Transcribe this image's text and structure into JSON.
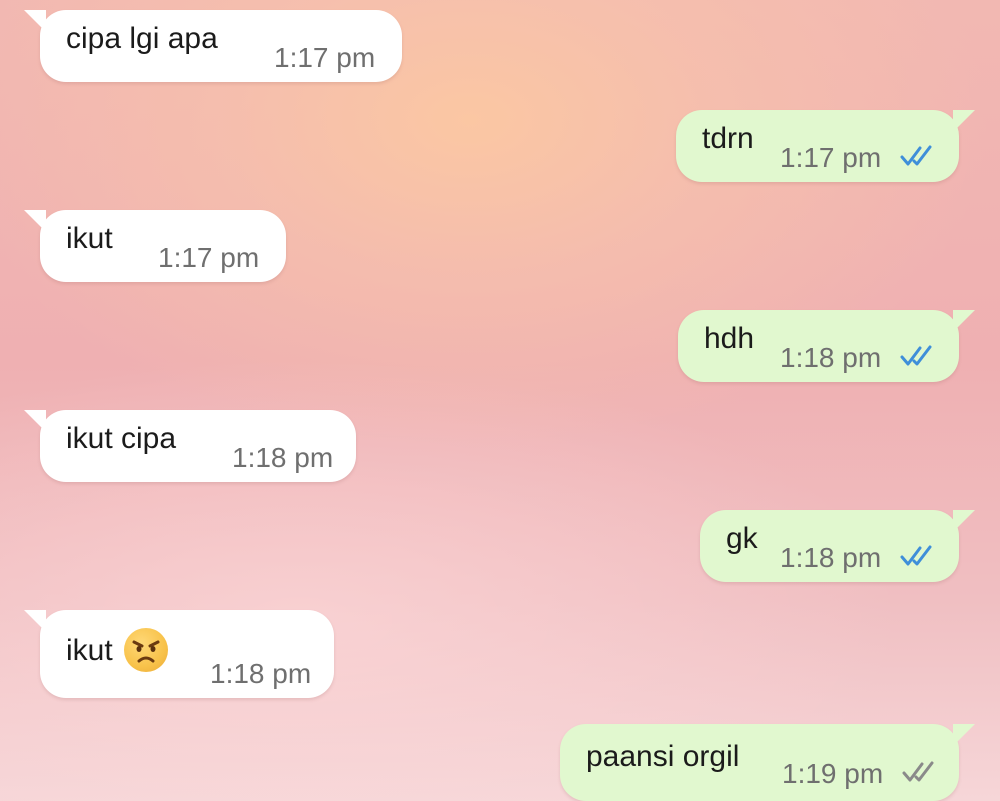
{
  "messages": [
    {
      "direction": "incoming",
      "text": "cipa lgi apa",
      "time": "1:17 pm"
    },
    {
      "direction": "outgoing",
      "text": "tdrn",
      "time": "1:17 pm",
      "status": "read",
      "status_icon": "double-check-icon",
      "status_color": "#3f8fd9"
    },
    {
      "direction": "incoming",
      "text": "ikut",
      "time": "1:17 pm"
    },
    {
      "direction": "outgoing",
      "text": "hdh",
      "time": "1:18 pm",
      "status": "read",
      "status_icon": "double-check-icon",
      "status_color": "#3f8fd9"
    },
    {
      "direction": "incoming",
      "text": "ikut cipa",
      "time": "1:18 pm"
    },
    {
      "direction": "outgoing",
      "text": "gk",
      "time": "1:18 pm",
      "status": "read",
      "status_icon": "double-check-icon",
      "status_color": "#3f8fd9"
    },
    {
      "direction": "incoming",
      "text": "ikut",
      "emoji": "angry-face-emoji",
      "time": "1:18 pm"
    },
    {
      "direction": "outgoing",
      "text": "paansi orgil",
      "time": "1:19 pm",
      "status": "delivered",
      "status_icon": "double-check-icon",
      "status_color": "#8a8a8a"
    }
  ]
}
